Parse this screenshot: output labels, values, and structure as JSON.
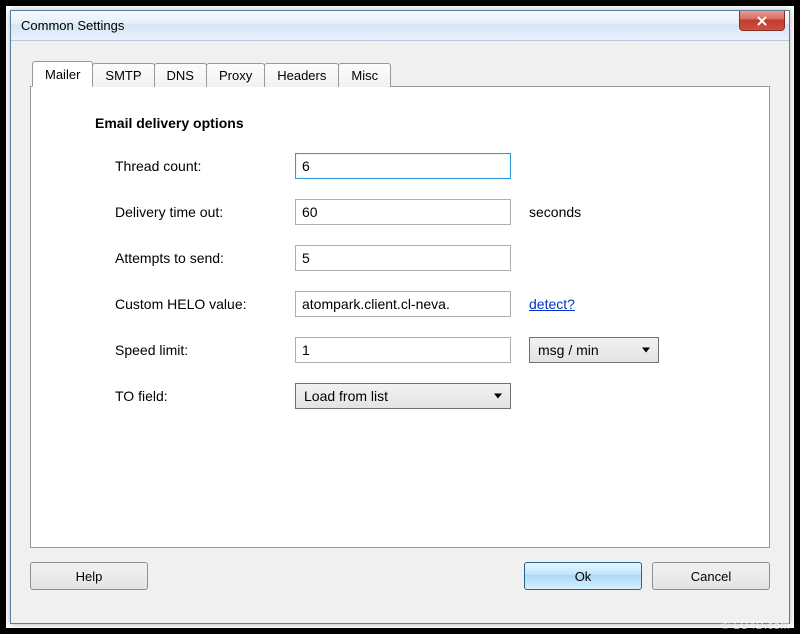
{
  "window": {
    "title": "Common Settings"
  },
  "tabs": {
    "mailer": "Mailer",
    "smtp": "SMTP",
    "dns": "DNS",
    "proxy": "Proxy",
    "headers": "Headers",
    "misc": "Misc"
  },
  "section": {
    "title": "Email delivery options"
  },
  "fields": {
    "thread_count": {
      "label": "Thread count:",
      "value": "6"
    },
    "delivery_timeout": {
      "label": "Delivery time out:",
      "value": "60",
      "suffix": "seconds"
    },
    "attempts": {
      "label": "Attempts to send:",
      "value": "5"
    },
    "custom_helo": {
      "label": "Custom HELO value:",
      "value": "atompark.client.cl-neva.",
      "link": "detect?"
    },
    "speed_limit": {
      "label": "Speed limit:",
      "value": "1",
      "unit": "msg / min"
    },
    "to_field": {
      "label": "TO field:",
      "value": "Load from list"
    }
  },
  "buttons": {
    "help": "Help",
    "ok": "Ok",
    "cancel": "Cancel"
  },
  "watermark": "© LO4D.com"
}
